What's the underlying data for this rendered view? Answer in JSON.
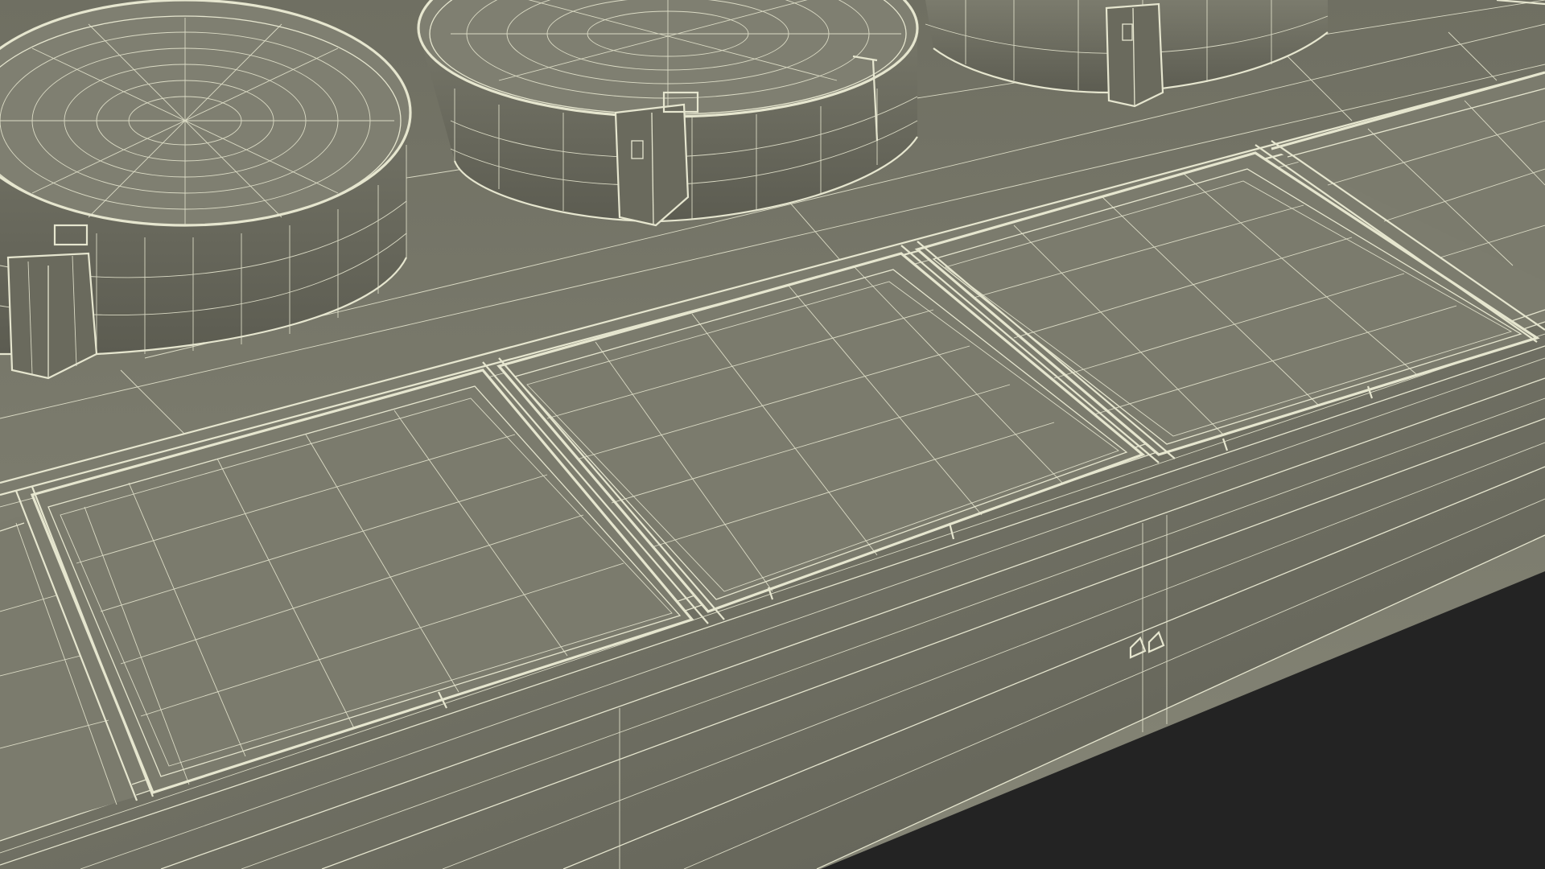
{
  "scene": {
    "description_hidden": "",
    "colors": {
      "background": "#232323",
      "ground": "#7a7a6c",
      "surface": "#7d7d6f",
      "shade": "#55554a",
      "wire": "#e6e6cf"
    },
    "objects": {
      "tanks": [
        "round-tank",
        "round-tank",
        "round-tank"
      ],
      "basins": [
        "rectangular-basin",
        "rectangular-basin",
        "rectangular-basin"
      ]
    }
  }
}
